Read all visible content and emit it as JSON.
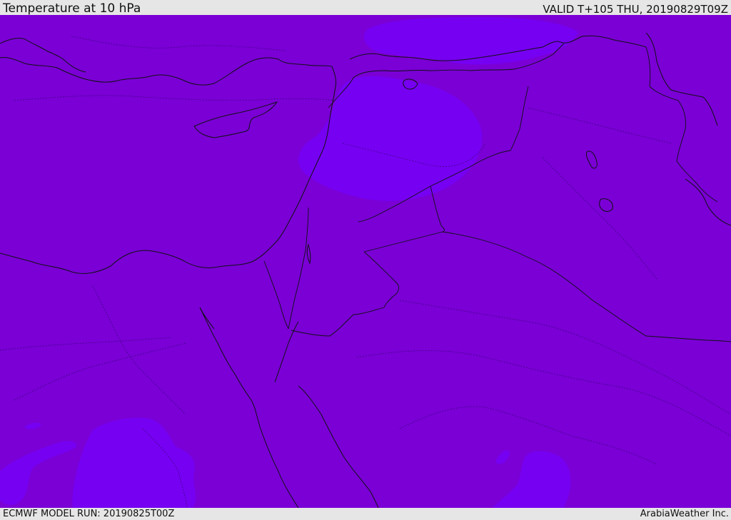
{
  "header": {
    "title": "Temperature at 10 hPa",
    "valid_time": "VALID T+105 THU, 20190829T09Z"
  },
  "footer": {
    "model_run": "ECMWF MODEL RUN: 20190825T00Z",
    "credit": "ArabiaWeather Inc."
  },
  "colors": {
    "base_field": "#7a00d6",
    "warmer_patch": "#7600f2",
    "frame": "#e6e6e6",
    "lines": "#111111"
  }
}
